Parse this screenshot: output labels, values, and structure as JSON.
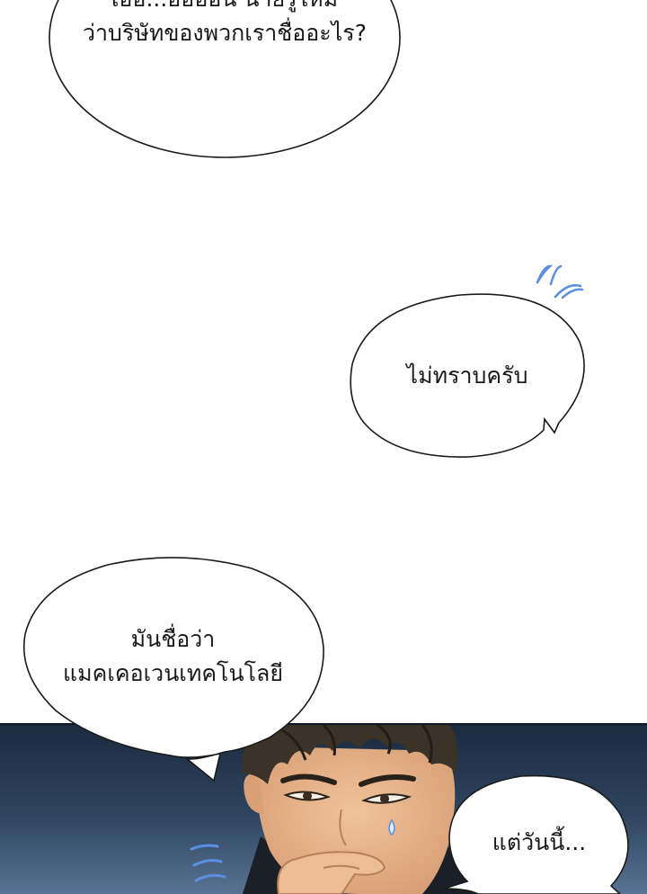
{
  "bubbles": {
    "top": {
      "line1": "เอ่อ...อ่อออน นายรู้ไหม",
      "line2": "ว่าบริษัทของพวกเราชื่ออะไร?"
    },
    "middle": {
      "line1": "ไม่ทราบครับ"
    },
    "lower_left": {
      "line1": "มันชื่อว่า",
      "line2": "แมคเคอเวนเทคโนโลยี"
    },
    "bottom_right": {
      "line1": "แต่วันนี้..."
    }
  },
  "colors": {
    "page_background": "#ffffff",
    "bubble_fill": "#ffffff",
    "bubble_outline": "#1a1a1a",
    "sweat_marks": "#5b8fe0",
    "night_background_top": "#1b2a3f",
    "night_background_bottom": "#5a7394",
    "hair": "#3b3327",
    "skin": "#e6b48d"
  }
}
